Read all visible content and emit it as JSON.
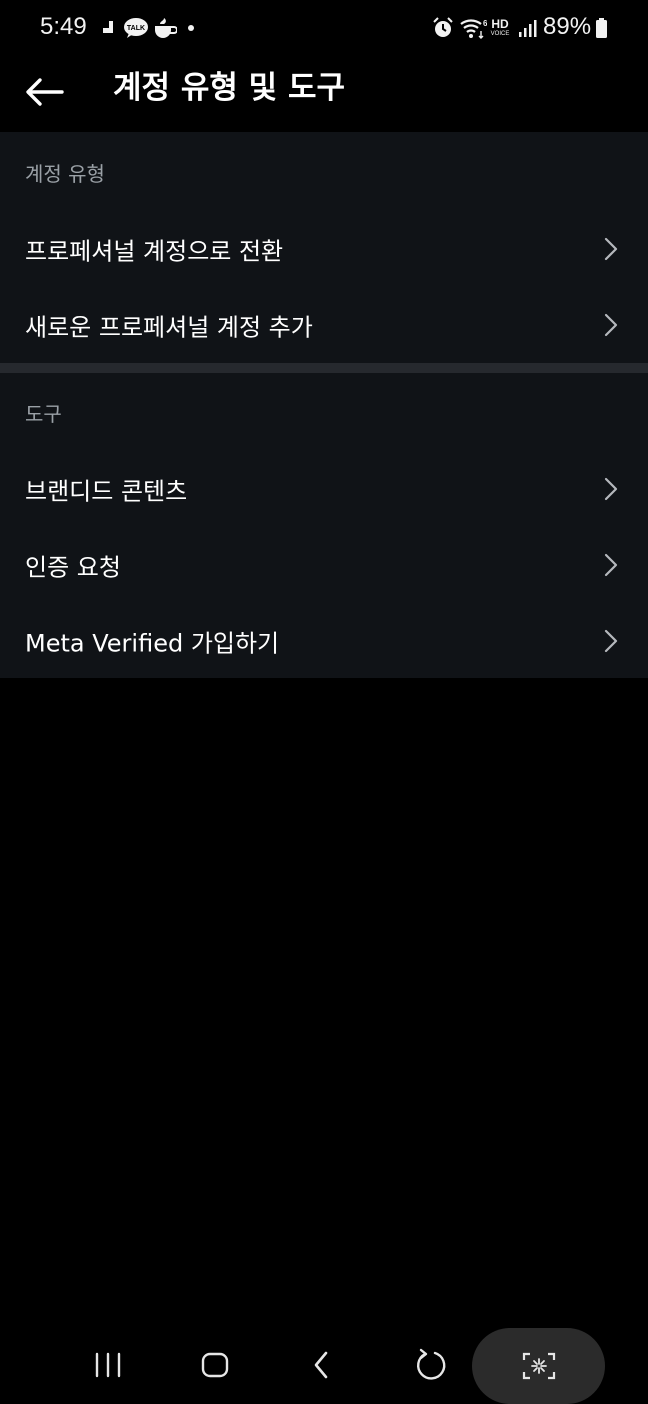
{
  "status_bar": {
    "time": "5:49",
    "battery_percent": "89%",
    "notification_icons": [
      "app-notification-icon",
      "talk-icon",
      "cup-icon",
      "dot-icon"
    ],
    "system_icons": [
      "alarm-icon",
      "wifi-6-icon",
      "hd-voice-icon",
      "signal-icon",
      "battery-icon"
    ],
    "talk_badge_text": "TALK",
    "hd_text": "HD",
    "voice_text": "VOICE"
  },
  "header": {
    "title": "계정 유형 및 도구",
    "back_icon": "arrow-left-icon"
  },
  "sections": [
    {
      "header": "계정 유형",
      "items": [
        {
          "label": "프로페셔널 계정으로 전환"
        },
        {
          "label": "새로운 프로페셔널 계정 추가"
        }
      ]
    },
    {
      "header": "도구",
      "items": [
        {
          "label": "브랜디드 콘텐츠"
        },
        {
          "label": "인증 요청"
        },
        {
          "label": "Meta Verified 가입하기"
        }
      ]
    }
  ],
  "nav_bar": {
    "buttons": [
      "recent-apps-icon",
      "home-icon",
      "back-icon",
      "rotate-icon",
      "screenshot-capture-icon"
    ]
  },
  "colors": {
    "background": "#000000",
    "section_background": "#101317",
    "divider": "#26292e",
    "muted_text": "#9aa0a6",
    "primary_text": "#ffffff"
  }
}
